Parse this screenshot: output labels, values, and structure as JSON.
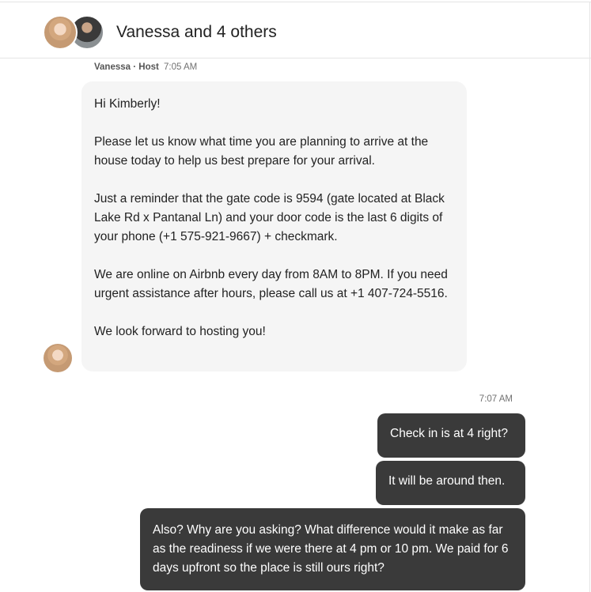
{
  "header": {
    "title": "Vanessa and 4 others",
    "avatars": [
      "avatar",
      "avatar"
    ]
  },
  "message_in": {
    "sender_name": "Vanessa · Host",
    "time": "7:05 AM",
    "paragraphs": [
      "Hi Kimberly!",
      "Please let us know what time you are planning to arrive at the house today to help us best prepare for your arrival.",
      "Just a reminder that the gate code is 9594 (gate located at Black Lake Rd x Pantanal Ln) and your door code is the last 6 digits of your phone (+1 575-921-9667) + checkmark.",
      "We are online on Airbnb every day from 8AM to 8PM. If you need urgent assistance after hours, please call us at +1 407-724-5516.",
      "We look forward to hosting you!"
    ]
  },
  "replies": {
    "time": "7:07 AM",
    "messages": [
      "Check in is at 4 right?",
      "It will be around then.",
      "Also? Why are you asking? What difference would it make as far as the readiness if we were there at 4 pm or 10 pm. We paid for 6 days upfront so the place is still ours right?"
    ]
  },
  "colors": {
    "incoming_bubble": "#f5f5f5",
    "outgoing_bubble": "#3a3a3a",
    "meta_text": "#717171"
  }
}
